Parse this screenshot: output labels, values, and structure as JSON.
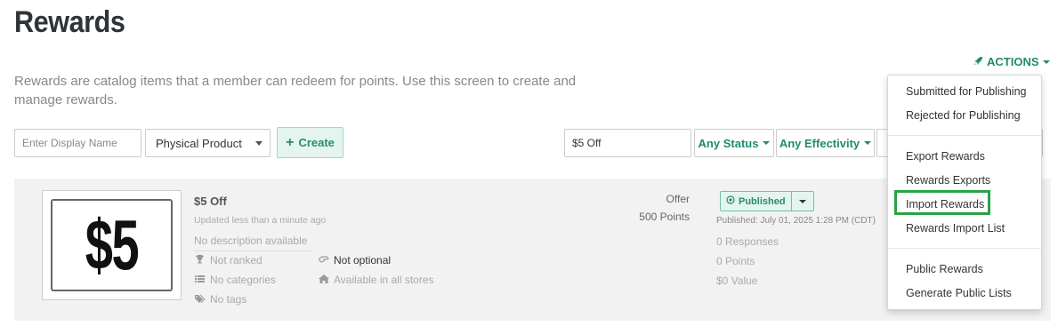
{
  "page": {
    "title": "Rewards",
    "description": "Rewards are catalog items that a member can redeem for points. Use this screen to create and manage rewards.",
    "actions_label": "ACTIONS"
  },
  "toolbar": {
    "display_name_placeholder": "Enter Display Name",
    "type_select_value": "Physical Product",
    "create_label": "Create",
    "search_value": "$5 Off",
    "status_filter": "Any Status",
    "effectivity_filter": "Any Effectivity"
  },
  "reward": {
    "image_text": "$5",
    "name": "$5 Off",
    "updated": "Updated less than a minute ago",
    "description": "No description available",
    "ranked": "Not ranked",
    "optional": "Not optional",
    "categories": "No categories",
    "stores": "Available in all stores",
    "tags": "No tags",
    "type": "Offer",
    "points_cost": "500 Points",
    "status": "Published",
    "published_date": "Published: July 01, 2025 1:28 PM (CDT)",
    "responses": "0 Responses",
    "points_stat": "0 Points",
    "value_stat": "$0 Value"
  },
  "actions_menu": {
    "items": [
      "Submitted for Publishing",
      "Rejected for Publishing",
      "Export Rewards",
      "Rewards Exports",
      "Import Rewards",
      "Rewards Import List",
      "Public Rewards",
      "Generate Public Lists"
    ]
  },
  "icons": {
    "actions": "rocket-icon",
    "create": "plus-icon",
    "status": "check-circle-icon",
    "ranked": "trophy-icon",
    "optional": "hand-icon",
    "categories": "list-icon",
    "stores": "home-icon",
    "tags": "tags-icon"
  },
  "colors": {
    "accent": "#1f8a70",
    "highlight": "#27a346"
  }
}
